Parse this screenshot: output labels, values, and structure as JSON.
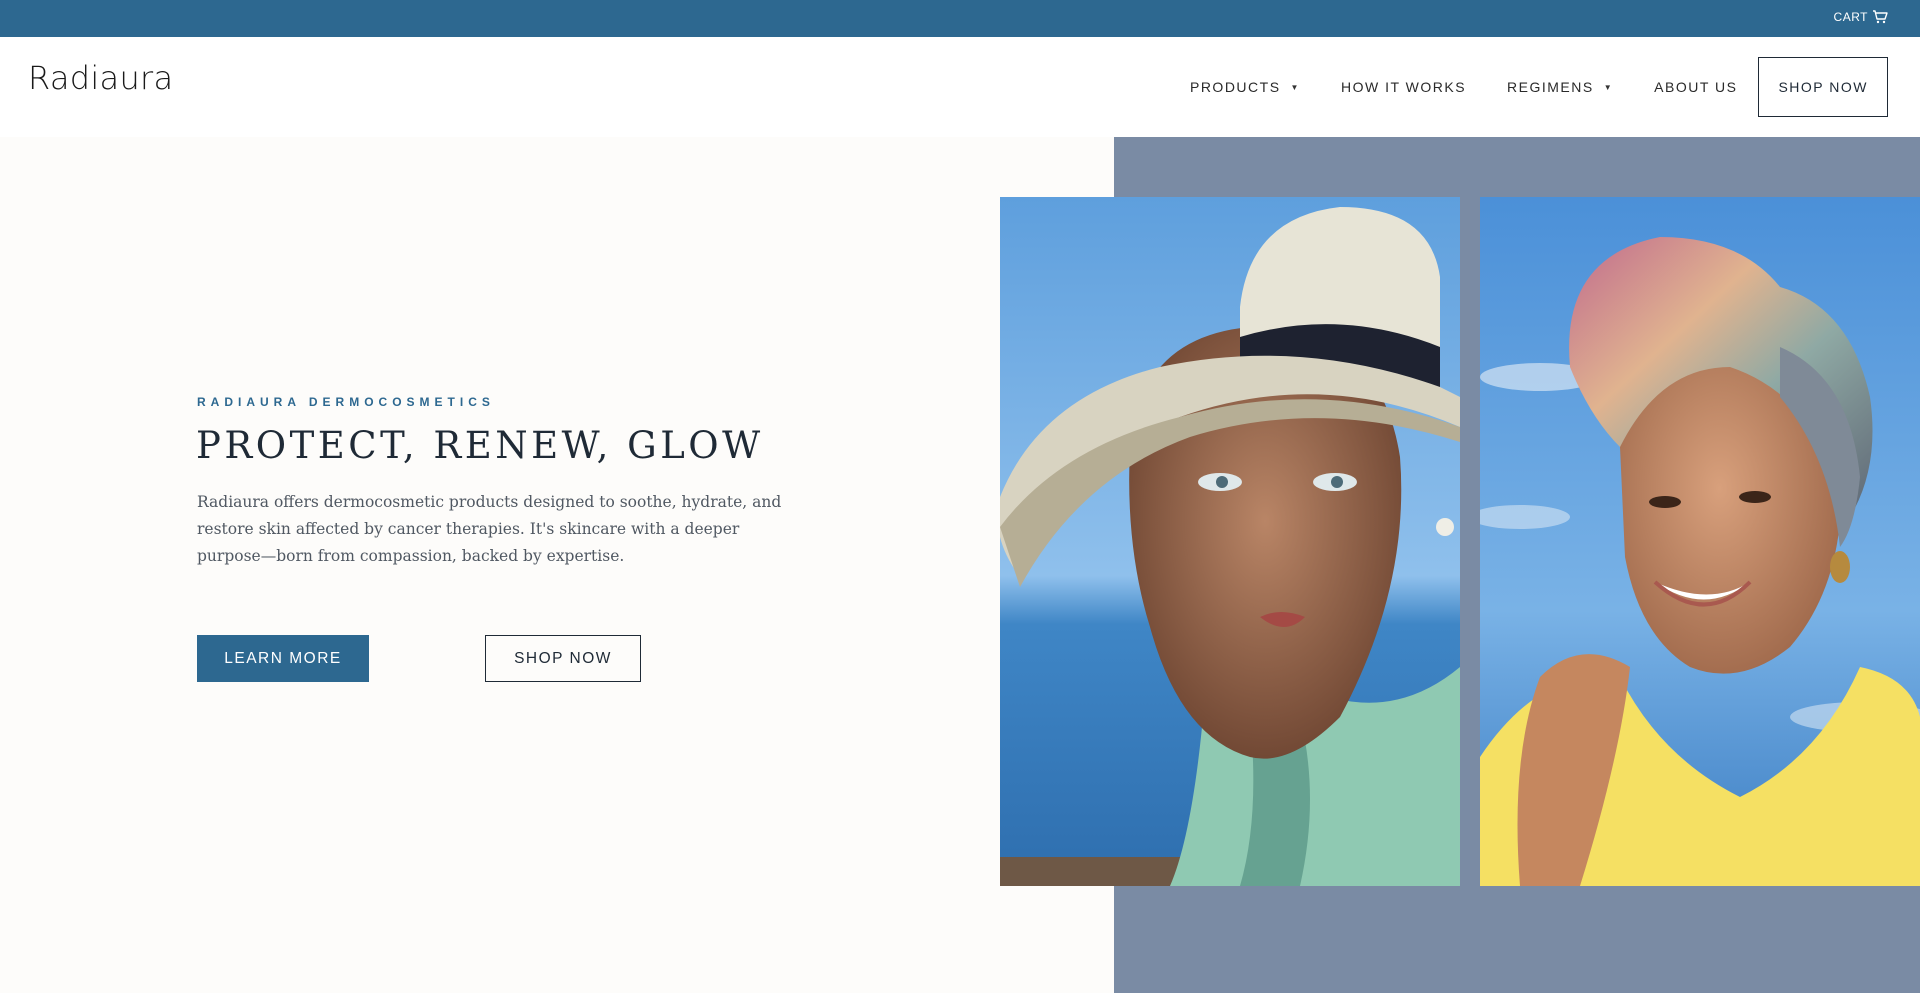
{
  "topbar": {
    "cart_label": "CART"
  },
  "header": {
    "logo": "Radiaura",
    "nav": [
      {
        "label": "PRODUCTS",
        "has_dropdown": true
      },
      {
        "label": "HOW IT WORKS",
        "has_dropdown": false
      },
      {
        "label": "REGIMENS",
        "has_dropdown": true
      },
      {
        "label": "ABOUT US",
        "has_dropdown": false
      }
    ],
    "shop_now_label": "SHOP NOW"
  },
  "hero": {
    "eyebrow": "RADIAURA DERMOCOSMETICS",
    "headline": "PROTECT, RENEW, GLOW",
    "description": "Radiaura offers dermocosmetic products designed to soothe, hydrate, and restore skin affected by cancer therapies. It's skincare with a deeper purpose—born from compassion, backed by expertise.",
    "learn_more_label": "LEARN MORE",
    "shop_now_label": "SHOP NOW"
  },
  "colors": {
    "brand_blue": "#2d6890",
    "panel_slate": "#7a8ba4",
    "text_dark": "#1f2a36",
    "background": "#fdfcfa"
  },
  "icons": {
    "cart": "cart-icon",
    "dropdown": "caret-down-icon"
  }
}
